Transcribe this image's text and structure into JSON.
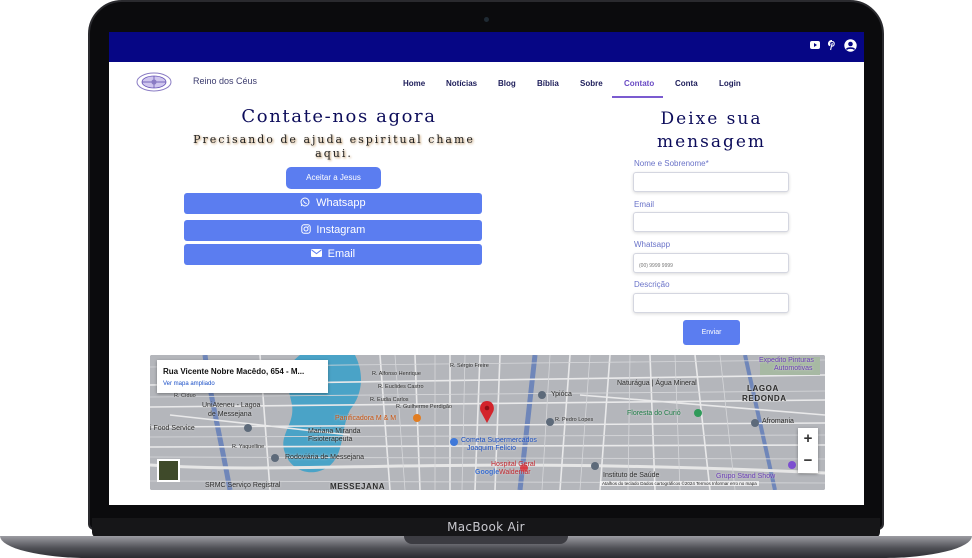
{
  "device": {
    "label": "MacBook Air"
  },
  "site": {
    "brand": "Reino dos Céus",
    "social_icons": [
      "youtube-icon",
      "pinterest-icon",
      "user-account-icon"
    ],
    "menu": [
      "Home",
      "Notícias",
      "Blog",
      "Bíblia",
      "Sobre",
      "Contato",
      "Conta",
      "Login"
    ],
    "active_menu": "Contato"
  },
  "contact": {
    "title": "Contate-nos agora",
    "subtitle_line1": "Precisando de ajuda espiritual chame",
    "subtitle_line2": "aqui.",
    "accept_button": "Aceitar a Jesus",
    "whatsapp_button": "Whatsapp",
    "instagram_button": "Instagram",
    "email_button": "Email"
  },
  "form": {
    "title_line1": "Deixe sua",
    "title_line2": "mensagem",
    "name_label": "Nome e Sobrenome*",
    "name_value": "",
    "email_label": "Email",
    "email_value": "",
    "whatsapp_label": "Whatsapp",
    "whatsapp_placeholder": "(00) 9999 9999",
    "description_label": "Descrição",
    "description_value": "",
    "submit": "Enviar"
  },
  "map": {
    "address": "Rua Vicente Nobre Macêdo, 654 - M...",
    "expand_link": "Ver mapa ampliado",
    "labels": {
      "lagoa_redonda_1": "LAGOA",
      "lagoa_redonda_2": "REDONDA",
      "messejana": "MESSEJANA",
      "naturagua": "Naturágua | Água Mineral",
      "expedito_1": "Expedito Pinturas",
      "expedito_2": "Automotivas",
      "ypioca": "Ypióca",
      "floresta": "Floresta do Curió",
      "afromania": "Afromania",
      "panificadora": "Panificadora M & M",
      "uniateneu_1": "UniAteneu - Lagoa",
      "uniateneu_2": "de Messejana",
      "food_service": "i Food Service",
      "mariana_1": "Mariana Miranda",
      "mariana_2": "Fisioterapeuta",
      "rodoviaria": "Rodoviária de Messejana",
      "cometa_1": "Cometa Supermercados",
      "cometa_2": "Joaquim Felício",
      "hospital_1": "Hospital Geral",
      "hospital_2": "Waldemar",
      "instituto": "Instituto de Saúde",
      "grupo": "Grupo Stand Show",
      "srmc": "SRMC Serviço Registral",
      "google": "Google",
      "zoom_in": "+",
      "zoom_out": "−",
      "attribution": "Atalhos do teclado   Dados cartográficos ©2024   Termos   Informar erro no mapa",
      "street_1": "R. Alfonso Henrique",
      "street_2": "R. Euclides Castro",
      "street_3": "R. Eudia Carlos",
      "street_4": "R. Guilherme Perdigão",
      "street_5": "R. Yaquelline",
      "street_6": "R. Cíduo",
      "street_7": "R. Pedro Lopes",
      "street_8": "R. Sérgio Freire"
    }
  }
}
